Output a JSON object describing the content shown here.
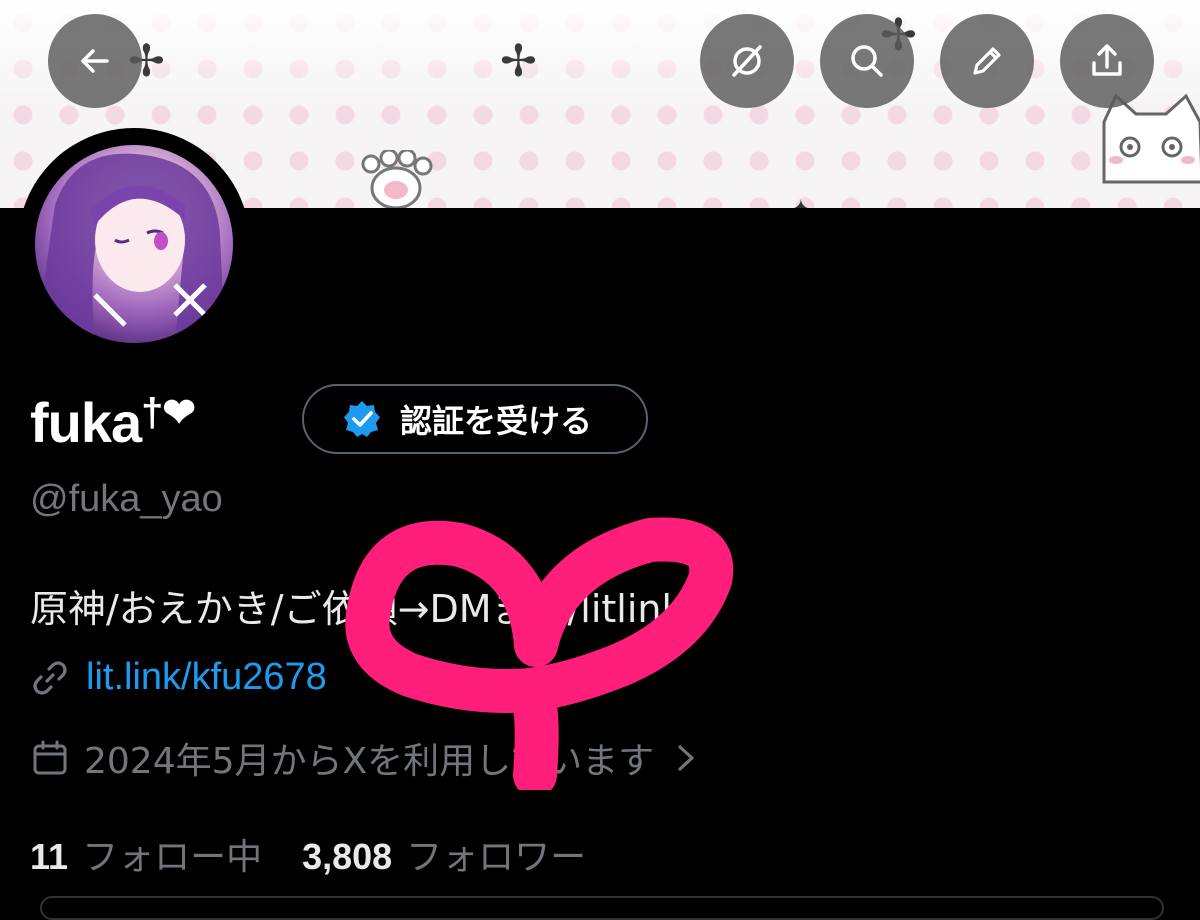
{
  "header": {
    "back_icon": "back-arrow-icon",
    "actions": [
      {
        "name": "grok-icon"
      },
      {
        "name": "search-icon"
      },
      {
        "name": "edit-icon"
      },
      {
        "name": "share-icon"
      }
    ]
  },
  "profile": {
    "display_name": "fuka",
    "name_suffix": "†❤",
    "verify_button_label": "認証を受ける",
    "handle": "@fuka_yao",
    "bio": "原神/おえかき/ご依頼→DMまで/litlink↓",
    "link": "lit.link/kfu2678",
    "joined": "2024年5月からXを利用しています",
    "following_count": "11",
    "following_label": "フォロー中",
    "followers_count": "3,808",
    "followers_label": "フォロワー"
  },
  "colors": {
    "background": "#000000",
    "link": "#1d9bf0",
    "muted": "#71767b",
    "verified_badge": "#1d9bf0",
    "scribble": "#ff1f7a"
  }
}
